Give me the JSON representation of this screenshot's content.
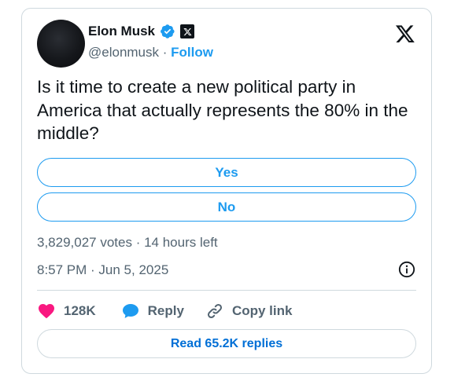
{
  "author": {
    "name": "Elon Musk",
    "handle": "@elonmusk",
    "separator": "·",
    "follow_label": "Follow"
  },
  "tweet": {
    "text": "Is it time to create a new political party in America that actually represents the 80% in the middle?"
  },
  "poll": {
    "options": [
      {
        "label": "Yes"
      },
      {
        "label": "No"
      }
    ],
    "votes_summary": "3,829,027 votes · 14 hours left"
  },
  "meta": {
    "timestamp": "8:57 PM · Jun 5, 2025"
  },
  "actions": {
    "likes_count": "128K",
    "reply_label": "Reply",
    "copy_link_label": "Copy link"
  },
  "replies": {
    "read_label": "Read 65.2K replies"
  },
  "icons": {
    "verified": "verified-badge-icon",
    "affiliate": "x-affiliate-badge-icon",
    "logo": "x-logo-icon",
    "info": "info-icon",
    "like": "heart-icon",
    "reply": "speech-bubble-icon",
    "link": "link-icon"
  },
  "colors": {
    "accent": "#1d9bf0",
    "link_blue": "#006fd6",
    "like_pink": "#f91880",
    "text_primary": "#0f1419",
    "text_secondary": "#536471",
    "border": "#cfd9de"
  }
}
